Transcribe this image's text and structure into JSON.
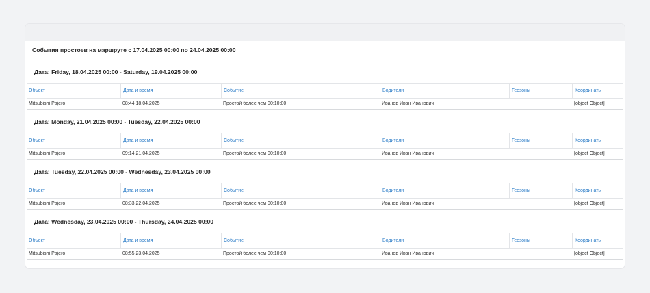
{
  "report": {
    "title": "События простоев на маршруте с 17.04.2025 00:00 по 24.04.2025 00:00"
  },
  "columns": [
    "Объект",
    "Дата и время",
    "Событие",
    "Водители",
    "Геозоны",
    "Координаты"
  ],
  "sections": [
    {
      "title": "Дата: Friday, 18.04.2025 00:00 - Saturday, 19.04.2025 00:00",
      "row": [
        "Mitsubishi Pajero",
        "08:44 18.04.2025",
        "Простой более чем 00:10:00",
        "Иванов Иван Иванович",
        "",
        "[object Object]"
      ]
    },
    {
      "title": "Дата: Monday, 21.04.2025 00:00 - Tuesday, 22.04.2025 00:00",
      "row": [
        "Mitsubishi Pajero",
        "09:14 21.04.2025",
        "Простой более чем 00:10:00",
        "Иванов Иван Иванович",
        "",
        "[object Object]"
      ]
    },
    {
      "title": "Дата: Tuesday, 22.04.2025 00:00 - Wednesday, 23.04.2025 00:00",
      "row": [
        "Mitsubishi Pajero",
        "08:33 22.04.2025",
        "Простой более чем 00:10:00",
        "Иванов Иван Иванович",
        "",
        "[object Object]"
      ]
    },
    {
      "title": "Дата: Wednesday, 23.04.2025 00:00 - Thursday, 24.04.2025 00:00",
      "row": [
        "Mitsubishi Pajero",
        "08:55 23.04.2025",
        "Простой более чем 00:10:00",
        "Иванов Иван Иванович",
        "",
        "[object Object]"
      ]
    }
  ]
}
